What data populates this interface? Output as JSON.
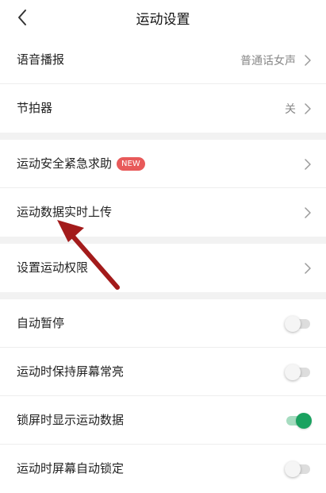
{
  "header": {
    "title": "运动设置",
    "back_icon": "chevron-left-icon"
  },
  "groups": [
    {
      "rows": [
        {
          "name": "voice-broadcast",
          "label": "语音播报",
          "value": "普通话女声",
          "control": "chevron"
        },
        {
          "name": "metronome",
          "label": "节拍器",
          "value": "关",
          "control": "chevron"
        }
      ]
    },
    {
      "rows": [
        {
          "name": "emergency-help",
          "label": "运动安全紧急求助",
          "badge": "NEW",
          "control": "chevron"
        },
        {
          "name": "realtime-upload",
          "label": "运动数据实时上传",
          "control": "chevron"
        }
      ]
    },
    {
      "rows": [
        {
          "name": "sport-permissions",
          "label": "设置运动权限",
          "control": "chevron"
        }
      ]
    },
    {
      "rows": [
        {
          "name": "auto-pause",
          "label": "自动暂停",
          "control": "switch",
          "on": false
        },
        {
          "name": "keep-screen-on",
          "label": "运动时保持屏幕常亮",
          "control": "switch",
          "on": false
        },
        {
          "name": "lock-screen-data",
          "label": "锁屏时显示运动数据",
          "control": "switch",
          "on": true
        },
        {
          "name": "auto-lock-screen",
          "label": "运动时屏幕自动锁定",
          "control": "switch",
          "on": false
        }
      ]
    }
  ],
  "colors": {
    "accent_green": "#1aa260",
    "badge_red": "#e85a5a",
    "annotation_arrow": "#a31b1b",
    "section_gap": "#f2f2f2"
  }
}
